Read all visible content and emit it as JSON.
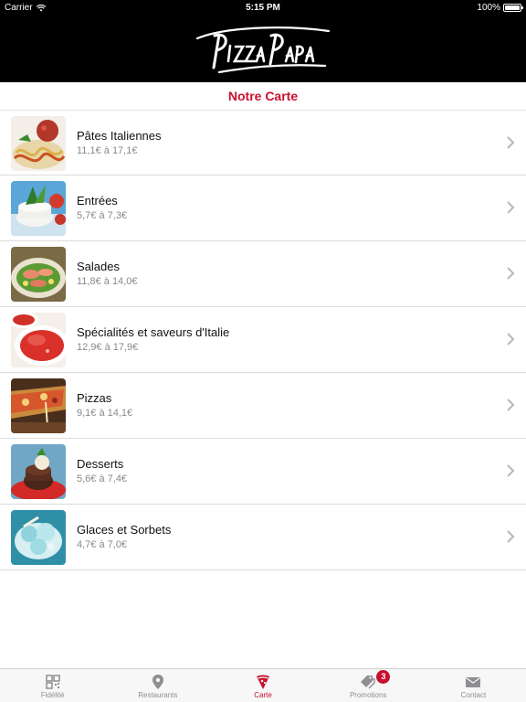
{
  "status_bar": {
    "carrier": "Carrier",
    "time": "5:15 PM",
    "battery": "100%"
  },
  "header": {
    "logo_text": "Pizza Papa"
  },
  "section_title": "Notre Carte",
  "menu": [
    {
      "title": "Pâtes Italiennes",
      "price": "11,1€ à 17,1€"
    },
    {
      "title": "Entrées",
      "price": "5,7€ à 7,3€"
    },
    {
      "title": "Salades",
      "price": "11,8€ à 14,0€"
    },
    {
      "title": "Spécialités et saveurs d'Italie",
      "price": "12,9€ à 17,9€"
    },
    {
      "title": "Pizzas",
      "price": "9,1€ à 14,1€"
    },
    {
      "title": "Desserts",
      "price": "5,6€ à 7,4€"
    },
    {
      "title": "Glaces et Sorbets",
      "price": "4,7€ à 7,0€"
    }
  ],
  "tabbar": {
    "tabs": [
      {
        "label": "Fidélité",
        "icon": "qr-code-icon"
      },
      {
        "label": "Restaurants",
        "icon": "map-pin-icon"
      },
      {
        "label": "Carte",
        "icon": "pizza-slice-icon",
        "active": true
      },
      {
        "label": "Promotions",
        "icon": "tags-icon",
        "badge": "3"
      },
      {
        "label": "Contact",
        "icon": "envelope-icon"
      }
    ]
  },
  "colors": {
    "accent": "#c8102e",
    "header_bg": "#000000",
    "tab_inactive": "#8e8e93"
  }
}
